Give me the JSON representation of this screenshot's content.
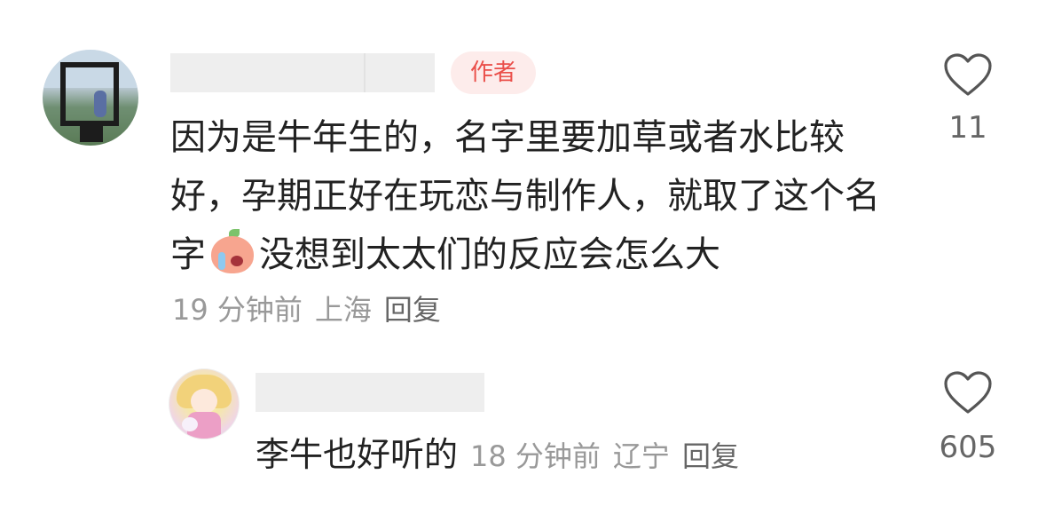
{
  "comments": [
    {
      "author_badge": "作者",
      "text": "因为是牛年生的，名字里要加草或者水比较好，孕期正好在玩恋与制作人，就取了这个名字",
      "emoji": "peach-crying-emoji",
      "text_after_emoji": "没想到太太们的反应会怎么大",
      "time": "19 分钟前",
      "location": "上海",
      "reply_label": "回复",
      "likes": "11",
      "avatar": "landscape-photo-avatar"
    },
    {
      "text": "李牛也好听的",
      "time": "18 分钟前",
      "location": "辽宁",
      "reply_label": "回复",
      "likes": "605",
      "avatar": "anime-girl-avatar"
    }
  ],
  "icons": {
    "like": "heart-outline-icon"
  },
  "colors": {
    "badge_text": "#ea4f4a",
    "badge_bg": "#fdeceb",
    "meta_text": "#999999",
    "body_text": "#222222"
  }
}
